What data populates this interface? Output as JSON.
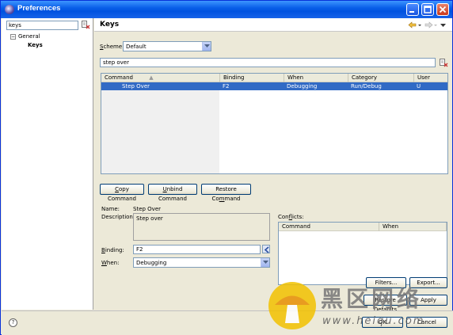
{
  "window": {
    "title": "Preferences"
  },
  "sidebar": {
    "filter_value": "keys",
    "tree": [
      {
        "label": "General",
        "expander": "−"
      },
      {
        "label": "Keys"
      }
    ]
  },
  "page": {
    "title": "Keys"
  },
  "scheme": {
    "label_prefix": "",
    "label_mnemonic": "S",
    "label_rest": "cheme:",
    "value": "Default"
  },
  "search": {
    "value": "step over"
  },
  "table": {
    "headers": [
      "Command",
      "Binding",
      "When",
      "Category",
      "User"
    ],
    "rows": [
      {
        "command": "Step Over",
        "binding": "F2",
        "when": "Debugging",
        "category": "Run/Debug",
        "user": "U"
      }
    ]
  },
  "buttons": {
    "copy": {
      "mn": "C",
      "rest": "opy Command"
    },
    "unbind": {
      "mn": "U",
      "rest": "nbind Command"
    },
    "restore": {
      "pre": "Restore Co",
      "mn": "m",
      "rest": "mand"
    },
    "filters": "Filters...",
    "export": "Export...",
    "restore_defaults": "Restore Defaults",
    "apply": "Apply",
    "ok": "OK",
    "cancel": "Cancel"
  },
  "details": {
    "name_label": "Name:",
    "name_value": "Step Over",
    "description_label": "Description:",
    "description_value": "Step over",
    "binding_label_mn": "B",
    "binding_label_rest": "inding:",
    "binding_value": "F2",
    "when_label_mn": "W",
    "when_label_rest": "hen:",
    "when_value": "Debugging",
    "conflicts_label_pre": "Con",
    "conflicts_label_mn": "f",
    "conflicts_label_rest": "licts:",
    "conflicts_headers": [
      "Command",
      "When"
    ]
  },
  "help": {
    "glyph": "?"
  },
  "watermark": {
    "brand": "黑区网络",
    "url": "www.heiqu.com"
  },
  "colors": {
    "title_bar": "#0a5fe8",
    "selection": "#316ac5",
    "dialog_bg": "#ece9d8"
  }
}
